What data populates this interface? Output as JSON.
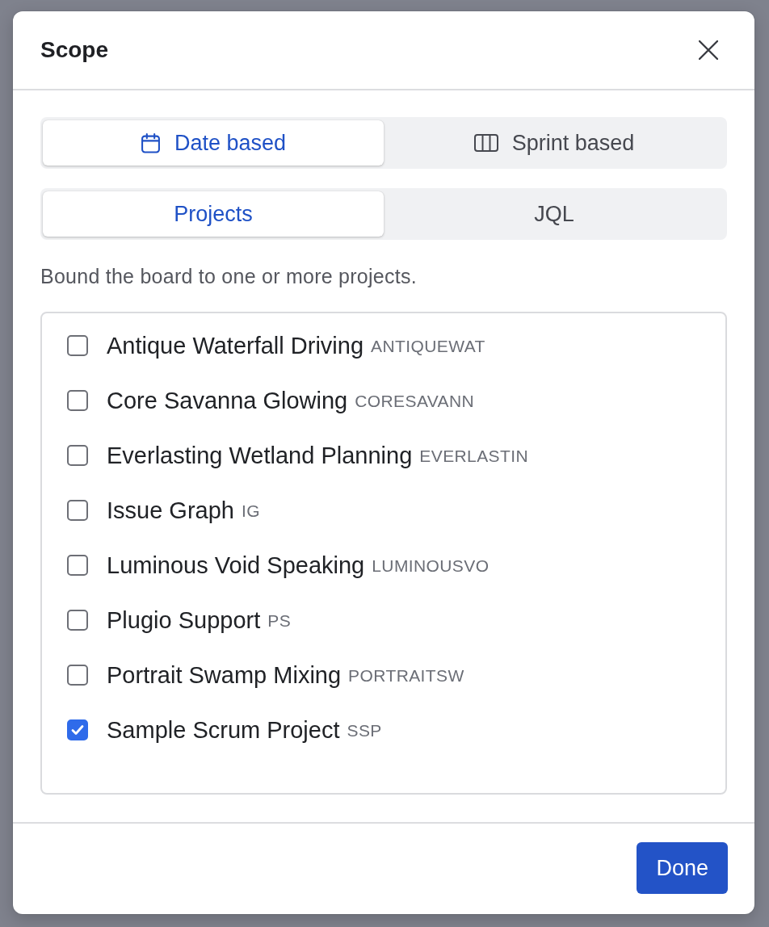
{
  "dialog": {
    "title": "Scope"
  },
  "mode_tabs": [
    {
      "label": "Date based",
      "selected": true
    },
    {
      "label": "Sprint based",
      "selected": false
    }
  ],
  "source_tabs": [
    {
      "label": "Projects",
      "selected": true
    },
    {
      "label": "JQL",
      "selected": false
    }
  ],
  "description": "Bound the board to one or more projects.",
  "projects": [
    {
      "name": "Antique Waterfall Driving",
      "key": "ANTIQUEWAT",
      "checked": false
    },
    {
      "name": "Core Savanna Glowing",
      "key": "CORESAVANN",
      "checked": false
    },
    {
      "name": "Everlasting Wetland Planning",
      "key": "EVERLASTIN",
      "checked": false
    },
    {
      "name": "Issue Graph",
      "key": "IG",
      "checked": false
    },
    {
      "name": "Luminous Void Speaking",
      "key": "LUMINOUSVO",
      "checked": false
    },
    {
      "name": "Plugio Support",
      "key": "PS",
      "checked": false
    },
    {
      "name": "Portrait Swamp Mixing",
      "key": "PORTRAITSW",
      "checked": false
    },
    {
      "name": "Sample Scrum Project",
      "key": "SSP",
      "checked": true
    }
  ],
  "buttons": [
    "Done"
  ]
}
